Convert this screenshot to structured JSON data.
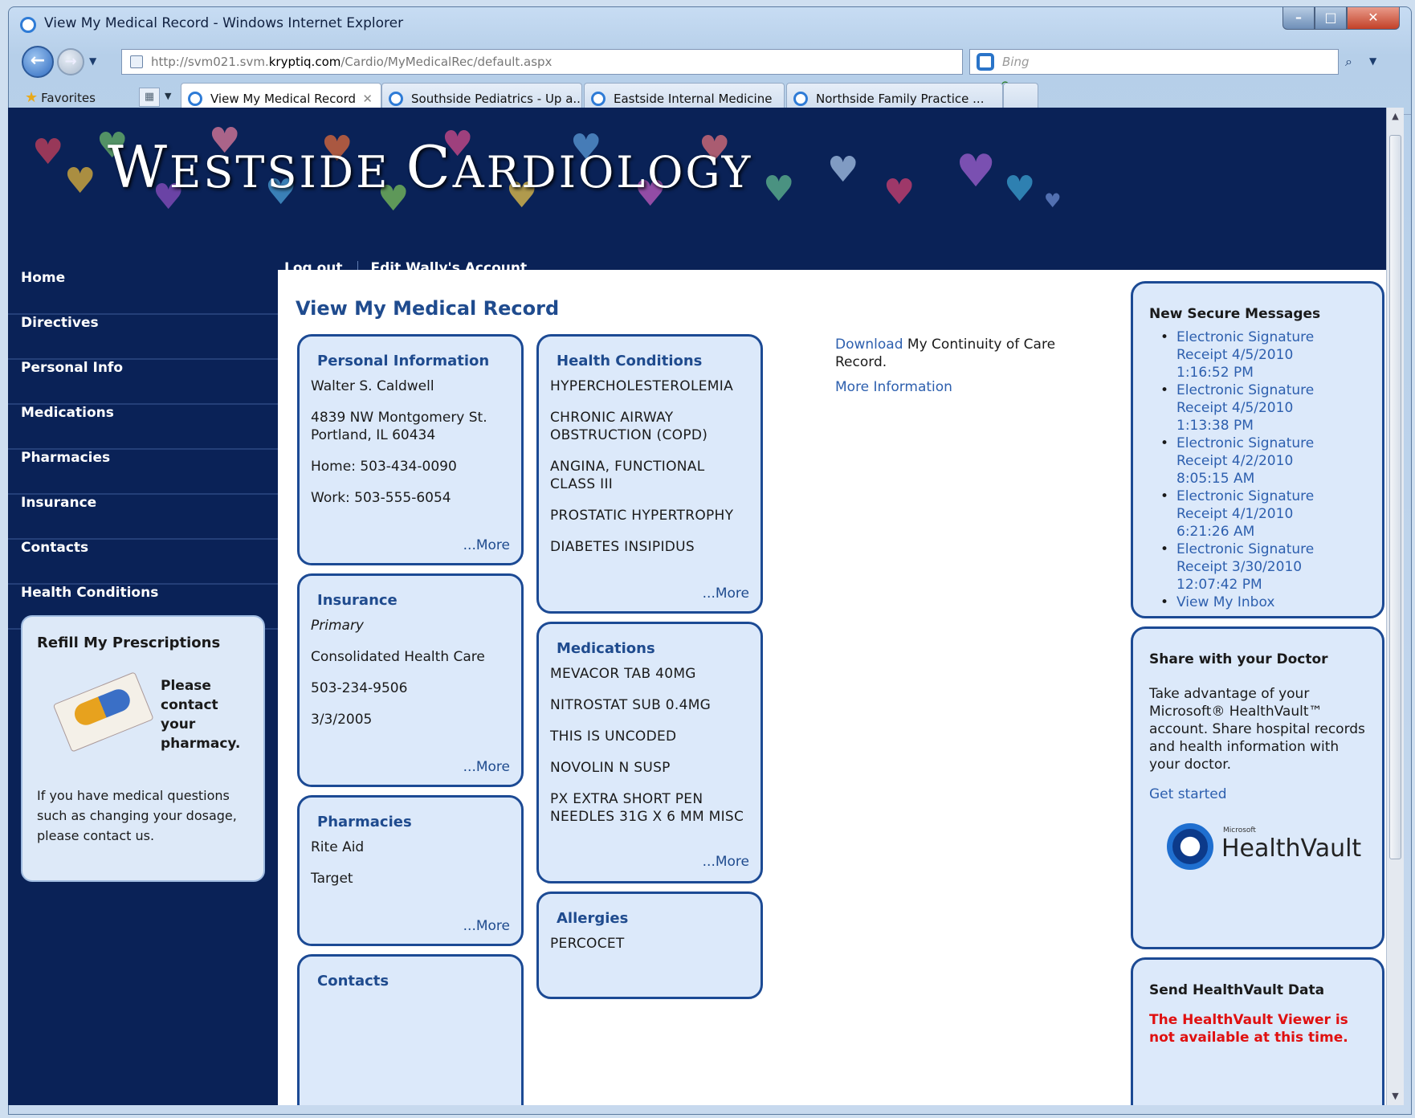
{
  "browser": {
    "title": "View My Medical Record - Windows Internet Explorer",
    "address": {
      "prefix": "http://svm021.svm.",
      "host": "kryptiq.com",
      "path": "/Cardio/MyMedicalRec/default.aspx"
    },
    "search_placeholder": "Bing",
    "favorites_label": "Favorites",
    "tabs": [
      {
        "label": "View My Medical Record",
        "active": true
      },
      {
        "label": "Southside Pediatrics - Up a...",
        "active": false
      },
      {
        "label": "Eastside Internal Medicine",
        "active": false
      },
      {
        "label": "Northside Family Practice ...",
        "active": false
      }
    ]
  },
  "site": {
    "brand": "WESTSIDE CARDIOLOGY",
    "brand_w": "W",
    "brand_rest1": "ESTSIDE ",
    "brand_c": "C",
    "brand_rest2": "ARDIOLOGY",
    "top_links": [
      "Log out",
      "Edit Wally's Account"
    ]
  },
  "sidebar": {
    "items": [
      "Home",
      "Directives",
      "Personal Info",
      "Medications",
      "Pharmacies",
      "Insurance",
      "Contacts",
      "Health Conditions"
    ],
    "refill": {
      "title": "Refill My Prescriptions",
      "please": "Please contact your pharmacy.",
      "note": "If you have medical questions such as changing your dosage, please contact us."
    }
  },
  "main": {
    "title": "View My Medical Record",
    "more_label": "...More",
    "personal": {
      "title": "Personal Information",
      "name": "Walter S. Caldwell",
      "address1": "4839 NW Montgomery St.",
      "address2": "Portland, IL 60434",
      "home": "Home: 503-434-0090",
      "work": "Work: 503-555-6054"
    },
    "insurance": {
      "title": "Insurance",
      "type": "Primary",
      "company": "Consolidated Health Care",
      "phone": "503-234-9506",
      "date": "3/3/2005"
    },
    "pharmacies": {
      "title": "Pharmacies",
      "items": [
        "Rite Aid",
        "Target"
      ]
    },
    "contacts": {
      "title": "Contacts"
    },
    "conditions": {
      "title": "Health Conditions",
      "items": [
        "HYPERCHOLESTEROLEMIA",
        "CHRONIC AIRWAY OBSTRUCTION (COPD)",
        "ANGINA, FUNCTIONAL CLASS III",
        "PROSTATIC HYPERTROPHY",
        "DIABETES INSIPIDUS"
      ]
    },
    "medications": {
      "title": "Medications",
      "items": [
        "MEVACOR TAB 40MG",
        "NITROSTAT SUB 0.4MG",
        "THIS IS UNCODED",
        "NOVOLIN N SUSP",
        "PX EXTRA SHORT PEN NEEDLES 31G X 6 MM MISC"
      ]
    },
    "allergies": {
      "title": "Allergies",
      "items": [
        "PERCOCET"
      ]
    },
    "download_link": "Download",
    "download_rest": " My Continuity of Care Record.",
    "more_information": "More Information"
  },
  "right": {
    "messages": {
      "title": "New Secure Messages",
      "items": [
        {
          "label": "Electronic Signature Receipt",
          "date": "4/5/2010",
          "time": "1:16:52 PM"
        },
        {
          "label": "Electronic Signature Receipt",
          "date": "4/5/2010",
          "time": "1:13:38 PM"
        },
        {
          "label": "Electronic Signature Receipt",
          "date": "4/2/2010",
          "time": "8:05:15 AM"
        },
        {
          "label": "Electronic Signature Receipt",
          "date": "4/1/2010",
          "time": "6:21:26 AM"
        },
        {
          "label": "Electronic Signature Receipt",
          "date": "3/30/2010",
          "time": "12:07:42 PM"
        }
      ],
      "inbox": "View My Inbox"
    },
    "share": {
      "title": "Share with your Doctor",
      "text": "Take advantage of your Microsoft® HealthVault™ account. Share hospital records and health information with your doctor.",
      "link": "Get started",
      "logo_small": "Microsoft",
      "logo_text": "HealthVault"
    },
    "send": {
      "title": "Send HealthVault Data",
      "warning": "The HealthVault Viewer is not available at this time."
    }
  },
  "colors": {
    "nav_bg": "#0a2257",
    "card_bg": "#dce9fa",
    "card_border": "#1c4a94",
    "link": "#2d5fae",
    "warning": "#e01010"
  }
}
